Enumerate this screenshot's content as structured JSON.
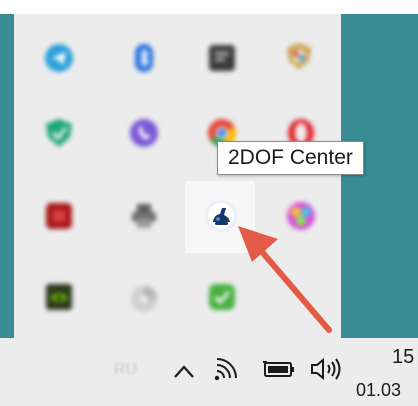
{
  "tooltip": {
    "text": "2DOF Center"
  },
  "taskbar": {
    "language": "RU",
    "clock_time": "15",
    "clock_date": "01.03"
  },
  "tray_icons": [
    {
      "name": "telegram-icon",
      "color": "#2b9fd9"
    },
    {
      "name": "bluetooth-icon",
      "color": "#1f6fde"
    },
    {
      "name": "app-dark-icon",
      "color": "#3c3c3c"
    },
    {
      "name": "shield-colorful-icon",
      "color": "#c9a04a"
    },
    {
      "name": "shield-green-icon",
      "color": "#1fa67a"
    },
    {
      "name": "viber-icon",
      "color": "#7b57d6"
    },
    {
      "name": "chrome-icon",
      "color": "#e5483a"
    },
    {
      "name": "opera-icon",
      "color": "#e0252b"
    },
    {
      "name": "red-app-icon",
      "color": "#a8191b"
    },
    {
      "name": "printer-icon",
      "color": "#6e6e6e"
    },
    {
      "name": "2dof-center-icon",
      "color": "#15366b"
    },
    {
      "name": "palette-icon",
      "color": "#d94fd8"
    },
    {
      "name": "nvidia-icon",
      "color": "#5a8a2a"
    },
    {
      "name": "disc-icon",
      "color": "#cfcfcf"
    },
    {
      "name": "green-check-icon",
      "color": "#48b042"
    }
  ],
  "colors": {
    "desktop": "#3a8c94",
    "panel": "#ececec",
    "arrow": "#e35a47"
  }
}
